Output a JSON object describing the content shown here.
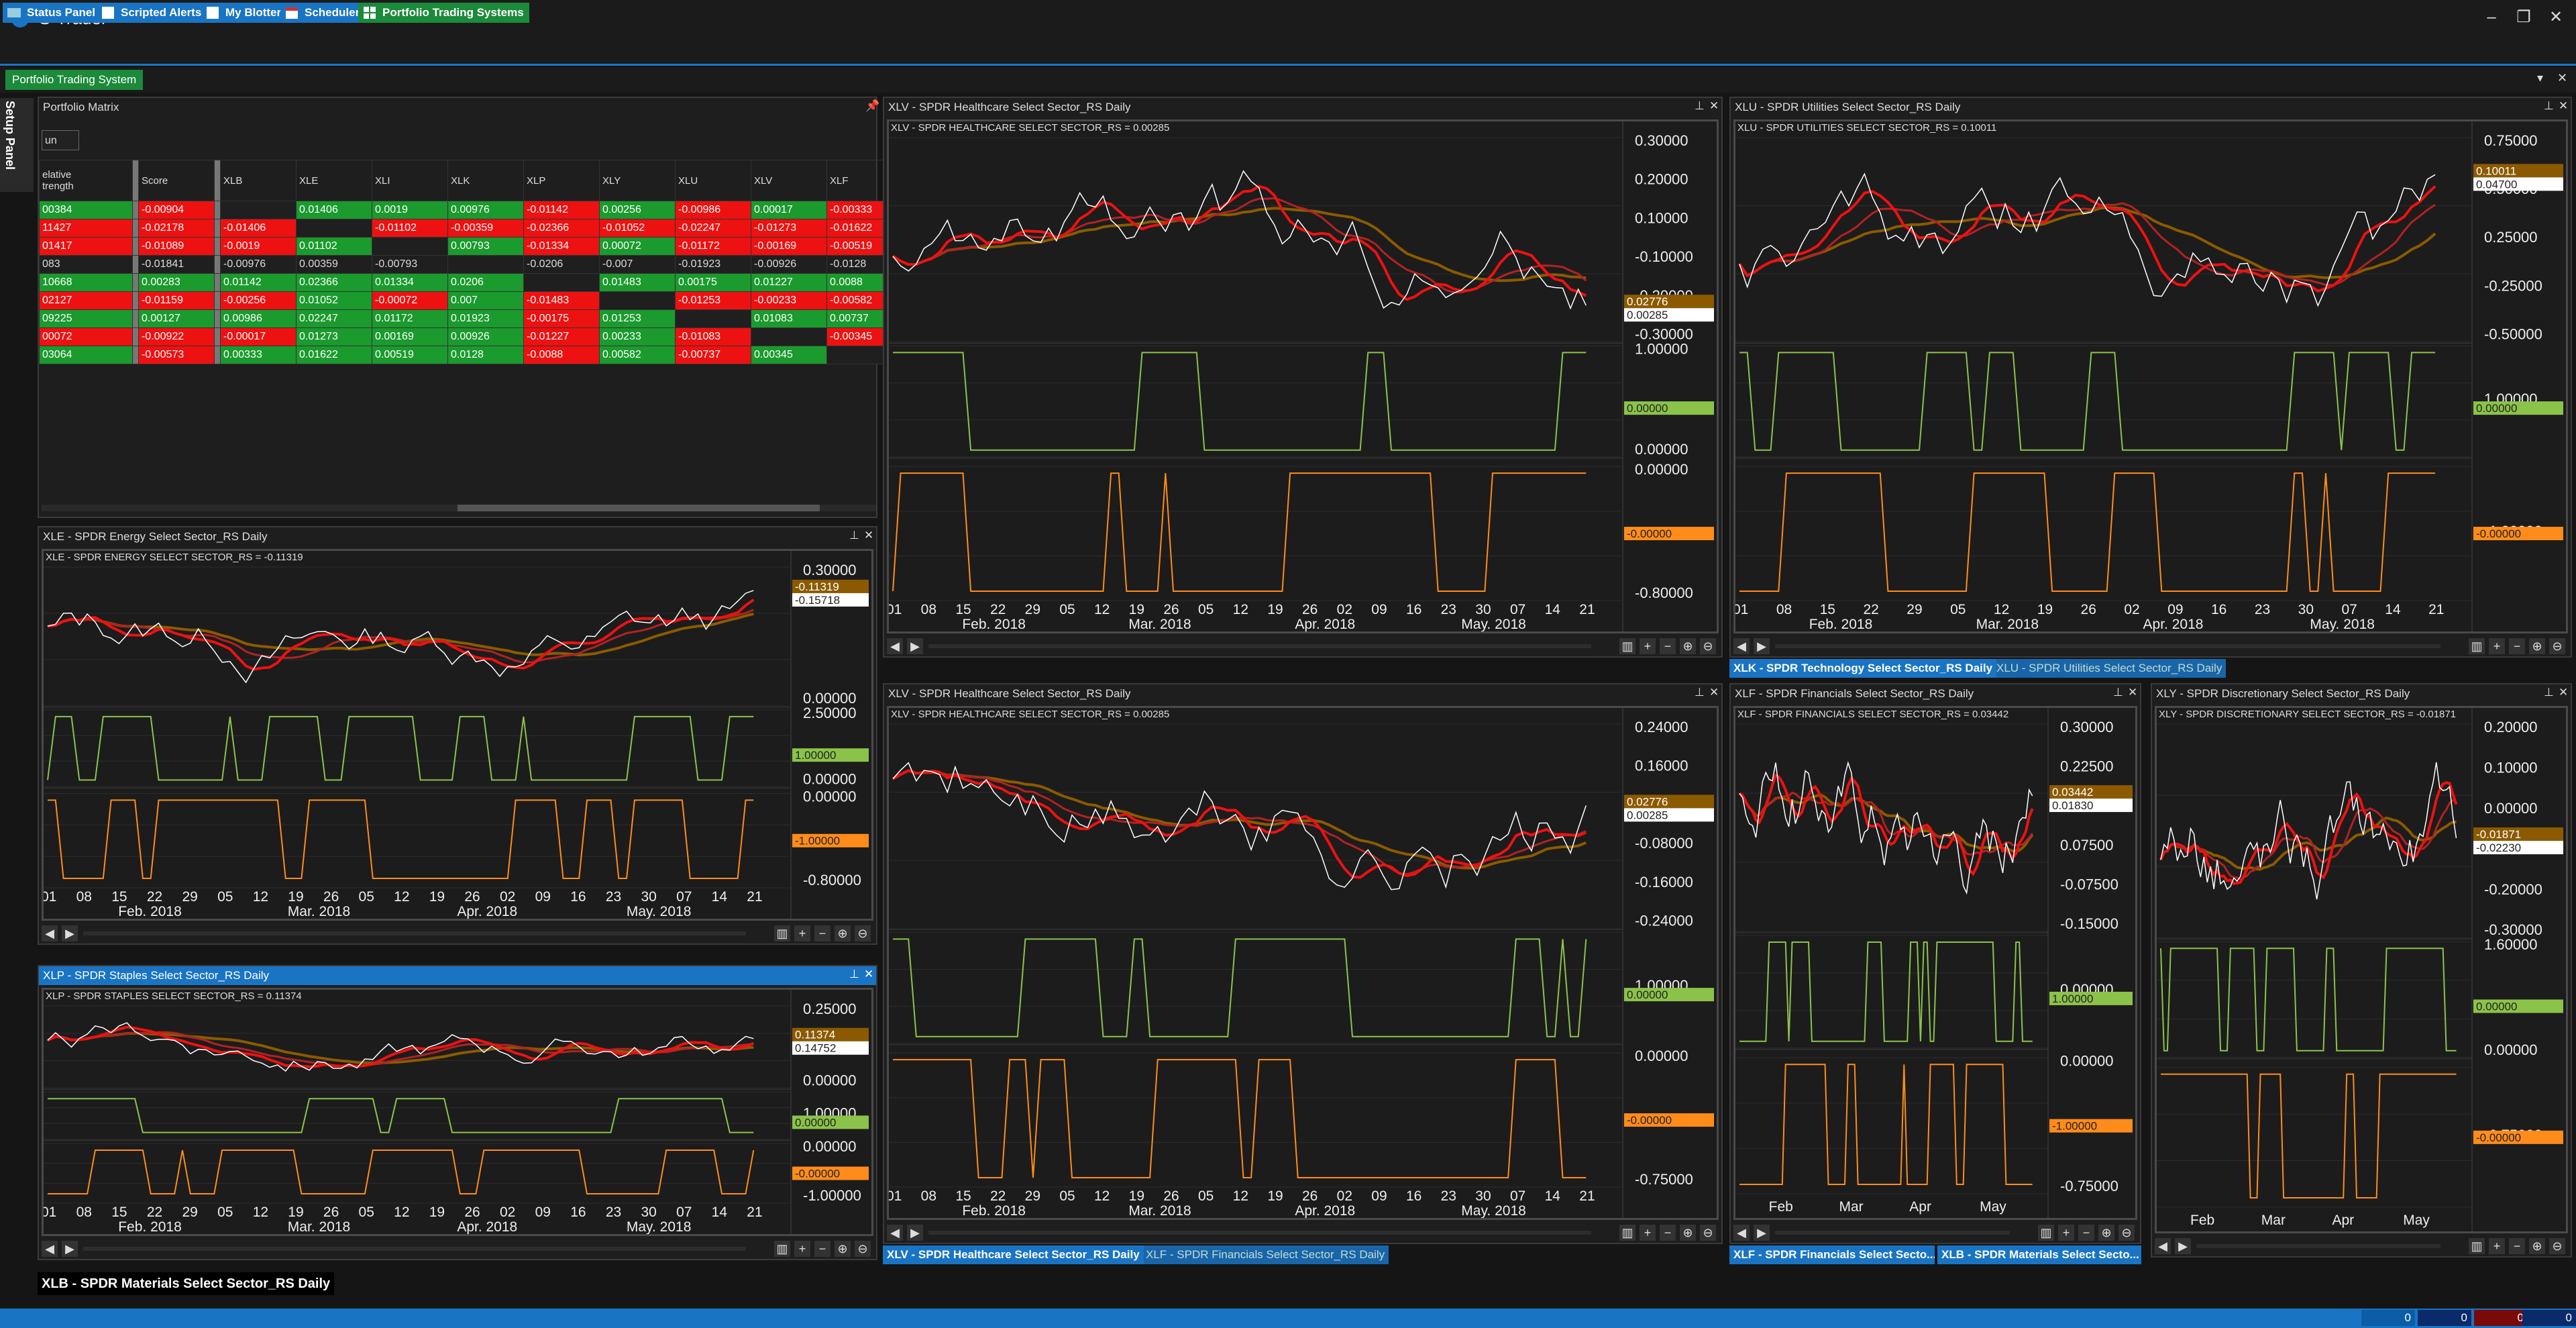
{
  "app": {
    "title": "S-Trader"
  },
  "toolbar": [
    {
      "label": "Status Panel"
    },
    {
      "label": "Scripted Alerts"
    },
    {
      "label": "My Blotter"
    },
    {
      "label": "Scheduler"
    },
    {
      "label": "Portfolio Trading Systems"
    }
  ],
  "doc_tab": "Portfolio Trading System",
  "setup_panel": "Setup Panel",
  "matrix": {
    "title": "Portfolio Matrix",
    "input_value": "un",
    "headers": [
      "elative\ntrength",
      "Score",
      "XLB",
      "XLE",
      "XLI",
      "XLK",
      "XLP",
      "XLY",
      "XLU",
      "XLV",
      "XLF"
    ],
    "rows": [
      {
        "c": [
          "00384",
          "-0.00904",
          "",
          "0.01406",
          "0.0019",
          "0.00976",
          "-0.01142",
          "0.00256",
          "-0.00986",
          "0.00017",
          "-0.00333"
        ],
        "s": [
          "g",
          "r",
          "k",
          "g",
          "g",
          "g",
          "r",
          "g",
          "r",
          "g",
          "r"
        ]
      },
      {
        "c": [
          "11427",
          "-0.02178",
          "-0.01406",
          "",
          "-0.01102",
          "-0.00359",
          "-0.02366",
          "-0.01052",
          "-0.02247",
          "-0.01273",
          "-0.01622"
        ],
        "s": [
          "r",
          "r",
          "r",
          "k",
          "r",
          "r",
          "r",
          "r",
          "r",
          "r",
          "r"
        ]
      },
      {
        "c": [
          "01417",
          "-0.01089",
          "-0.0019",
          "0.01102",
          "",
          "0.00793",
          "-0.01334",
          "0.00072",
          "-0.01172",
          "-0.00169",
          "-0.00519"
        ],
        "s": [
          "r",
          "r",
          "r",
          "g",
          "k",
          "g",
          "r",
          "g",
          "r",
          "r",
          "r"
        ]
      },
      {
        "c": [
          "083",
          "-0.01841",
          "-0.00976",
          "0.00359",
          "-0.00793",
          "",
          "-0.0206",
          "-0.007",
          "-0.01923",
          "-0.00926",
          "-0.0128"
        ],
        "s": [
          "k",
          "k",
          "k",
          "k",
          "k",
          "k",
          "k",
          "k",
          "k",
          "k",
          "k"
        ]
      },
      {
        "c": [
          "10668",
          "0.00283",
          "0.01142",
          "0.02366",
          "0.01334",
          "0.0206",
          "",
          "0.01483",
          "0.00175",
          "0.01227",
          "0.0088"
        ],
        "s": [
          "g",
          "g",
          "g",
          "g",
          "g",
          "g",
          "k",
          "g",
          "g",
          "g",
          "g"
        ]
      },
      {
        "c": [
          "02127",
          "-0.01159",
          "-0.00256",
          "0.01052",
          "-0.00072",
          "0.007",
          "-0.01483",
          "",
          "-0.01253",
          "-0.00233",
          "-0.00582"
        ],
        "s": [
          "r",
          "r",
          "r",
          "g",
          "r",
          "g",
          "r",
          "k",
          "r",
          "r",
          "r"
        ]
      },
      {
        "c": [
          "09225",
          "0.00127",
          "0.00986",
          "0.02247",
          "0.01172",
          "0.01923",
          "-0.00175",
          "0.01253",
          "",
          "0.01083",
          "0.00737"
        ],
        "s": [
          "g",
          "g",
          "g",
          "g",
          "g",
          "g",
          "r",
          "g",
          "k",
          "g",
          "g"
        ]
      },
      {
        "c": [
          "00072",
          "-0.00922",
          "-0.00017",
          "0.01273",
          "0.00169",
          "0.00926",
          "-0.01227",
          "0.00233",
          "-0.01083",
          "",
          "-0.00345"
        ],
        "s": [
          "r",
          "r",
          "r",
          "g",
          "g",
          "g",
          "r",
          "g",
          "r",
          "k",
          "r"
        ]
      },
      {
        "c": [
          "03064",
          "-0.00573",
          "0.00333",
          "0.01622",
          "0.00519",
          "0.0128",
          "-0.0088",
          "0.00582",
          "-0.00737",
          "0.00345",
          ""
        ],
        "s": [
          "g",
          "r",
          "g",
          "g",
          "g",
          "g",
          "r",
          "g",
          "r",
          "g",
          "k"
        ]
      }
    ]
  },
  "charts": {
    "xle": {
      "title": "XLE - SPDR Energy Select Sector_RS Daily",
      "legend": "XLE - SPDR ENERGY SELECT SECTOR_RS = -0.11319",
      "p1_labels": [
        "0.30000",
        "0.00000"
      ],
      "p1_tags": [
        "-0.11319",
        "-0.15718"
      ],
      "p2_labels": [
        "2.50000",
        "0.00000"
      ],
      "p2_tag": "1.00000",
      "p3_labels": [
        "0.00000",
        "-0.80000"
      ],
      "p3_tag": "-1.00000",
      "x_days": [
        "01",
        "08",
        "15",
        "22",
        "29",
        "05",
        "12",
        "19",
        "26",
        "05",
        "12",
        "19",
        "26",
        "02",
        "09",
        "16",
        "23",
        "30",
        "07",
        "14",
        "21"
      ],
      "x_months": [
        "Feb. 2018",
        "Mar. 2018",
        "Apr. 2018",
        "May. 2018"
      ]
    },
    "xlp": {
      "title": "XLP - SPDR Staples Select Sector_RS Daily",
      "legend": "XLP - SPDR STAPLES SELECT SECTOR_RS = 0.11374",
      "p1_labels": [
        "0.25000",
        "0.00000"
      ],
      "p1_tags": [
        "0.11374",
        "0.14752"
      ],
      "p2_labels": [
        "1.00000"
      ],
      "p2_tag": "0.00000",
      "p3_labels": [
        "0.00000",
        "-1.00000"
      ],
      "p3_tag": "-0.00000",
      "x_days": [
        "01",
        "08",
        "15",
        "22",
        "29",
        "05",
        "12",
        "19",
        "26",
        "05",
        "12",
        "19",
        "26",
        "02",
        "09",
        "16",
        "23",
        "30",
        "07",
        "14",
        "21"
      ],
      "x_months": [
        "Feb. 2018",
        "Mar. 2018",
        "Apr. 2018",
        "May. 2018"
      ]
    },
    "xlv1": {
      "title": "XLV - SPDR Healthcare Select Sector_RS Daily",
      "legend": "XLV - SPDR HEALTHCARE SELECT SECTOR_RS = 0.00285",
      "p1_labels": [
        "0.30000",
        "0.20000",
        "0.10000",
        "-0.10000",
        "-0.20000",
        "-0.30000"
      ],
      "p1_tags": [
        "0.02776",
        "0.00285"
      ],
      "p2_labels": [
        "1.00000",
        "0.00000"
      ],
      "p2_tag": "0.00000",
      "p3_labels": [
        "0.00000",
        "-0.80000"
      ],
      "p3_tag": "-0.00000",
      "x_days": [
        "01",
        "08",
        "15",
        "22",
        "29",
        "05",
        "12",
        "19",
        "26",
        "05",
        "12",
        "19",
        "26",
        "02",
        "09",
        "16",
        "23",
        "30",
        "07",
        "14",
        "21"
      ],
      "x_months": [
        "Feb. 2018",
        "Mar. 2018",
        "Apr. 2018",
        "May. 2018"
      ]
    },
    "xlv2": {
      "title": "XLV - SPDR Healthcare Select Sector_RS Daily",
      "legend": "XLV - SPDR HEALTHCARE SELECT SECTOR_RS = 0.00285",
      "p1_labels": [
        "0.24000",
        "0.16000",
        "0.08000",
        "-0.08000",
        "-0.16000",
        "-0.24000"
      ],
      "p1_tags": [
        "0.02776",
        "0.00285"
      ],
      "p2_labels": [
        "1.00000"
      ],
      "p2_tag": "0.00000",
      "p3_labels": [
        "0.00000",
        "-0.75000"
      ],
      "p3_tag": "-0.00000",
      "x_days": [
        "01",
        "08",
        "15",
        "22",
        "29",
        "05",
        "12",
        "19",
        "26",
        "05",
        "12",
        "19",
        "26",
        "02",
        "09",
        "16",
        "23",
        "30",
        "07",
        "14",
        "21"
      ],
      "x_months": [
        "Feb. 2018",
        "Mar. 2018",
        "Apr. 2018",
        "May. 2018"
      ]
    },
    "xlu": {
      "title": "XLU - SPDR Utilities Select Sector_RS Daily",
      "legend": "XLU - SPDR UTILITIES SELECT SECTOR_RS = 0.10011",
      "p1_labels": [
        "0.75000",
        "0.50000",
        "0.25000",
        "-0.25000",
        "-0.50000"
      ],
      "p1_tags": [
        "0.10011",
        "0.04700"
      ],
      "p2_labels": [
        "1.00000"
      ],
      "p2_tag": "0.00000",
      "p3_labels": [
        "-1.00000"
      ],
      "p3_tag": "-0.00000",
      "x_days": [
        "01",
        "08",
        "15",
        "22",
        "29",
        "05",
        "12",
        "19",
        "26",
        "02",
        "09",
        "16",
        "23",
        "30",
        "07",
        "14",
        "21"
      ],
      "x_months": [
        "Feb. 2018",
        "Mar. 2018",
        "Apr. 2018",
        "May. 2018"
      ]
    },
    "xlf": {
      "title": "XLF - SPDR Financials Select Sector_RS Daily",
      "legend": "XLF - SPDR FINANCIALS SELECT SECTOR_RS = 0.03442",
      "p1_labels": [
        "0.30000",
        "0.22500",
        "0.15000",
        "0.07500",
        "-0.07500",
        "-0.15000"
      ],
      "p1_tags": [
        "0.03442",
        "0.01830"
      ],
      "p2_labels": [
        "0.00000"
      ],
      "p2_tag": "1.00000",
      "p3_labels": [
        "0.00000",
        "-0.75000"
      ],
      "p3_tag": "-1.00000",
      "x_days": [],
      "x_months": [
        "Feb",
        "Mar",
        "Apr",
        "May"
      ]
    },
    "xly": {
      "title": "XLY - SPDR Discretionary Select Sector_RS Daily",
      "legend": "XLY - SPDR DISCRETIONARY SELECT SECTOR_RS = -0.01871",
      "p1_labels": [
        "0.20000",
        "0.10000",
        "0.00000",
        "-0.10000",
        "-0.20000",
        "-0.30000"
      ],
      "p1_tags": [
        "-0.01871",
        "-0.02230"
      ],
      "p2_labels": [
        "1.60000",
        "0.00000"
      ],
      "p2_tag": "0.00000",
      "p3_labels": [
        "-0.75000"
      ],
      "p3_tag": "-0.00000",
      "x_days": [],
      "x_months": [
        "Feb",
        "Mar",
        "Apr",
        "May"
      ]
    }
  },
  "bottom_tabs": {
    "left": [
      "XLB - SPDR Materials Select Sector_RS Daily"
    ],
    "mid": [
      "XLV - SPDR Healthcare Select Sector_RS Daily",
      "XLF - SPDR Financials Select Sector_RS Daily"
    ],
    "right_top": [
      "XLK - SPDR Technology Select Sector_RS Daily",
      "XLU - SPDR Utilities Select Sector_RS Daily"
    ],
    "right_bottom": [
      "XLF - SPDR Financials Select Secto...",
      "XLB - SPDR Materials Select Secto..."
    ]
  },
  "status": {
    "values": [
      "0",
      "0",
      "0",
      "0"
    ]
  },
  "colors": {
    "accent": "#1a74c4",
    "green": "#1b9a2e",
    "red": "#ee1111",
    "white": "#ffffff",
    "signal_green": "#8bc34a",
    "signal_orange": "#ff8c1a",
    "ma_dark": "#8b5a00"
  }
}
